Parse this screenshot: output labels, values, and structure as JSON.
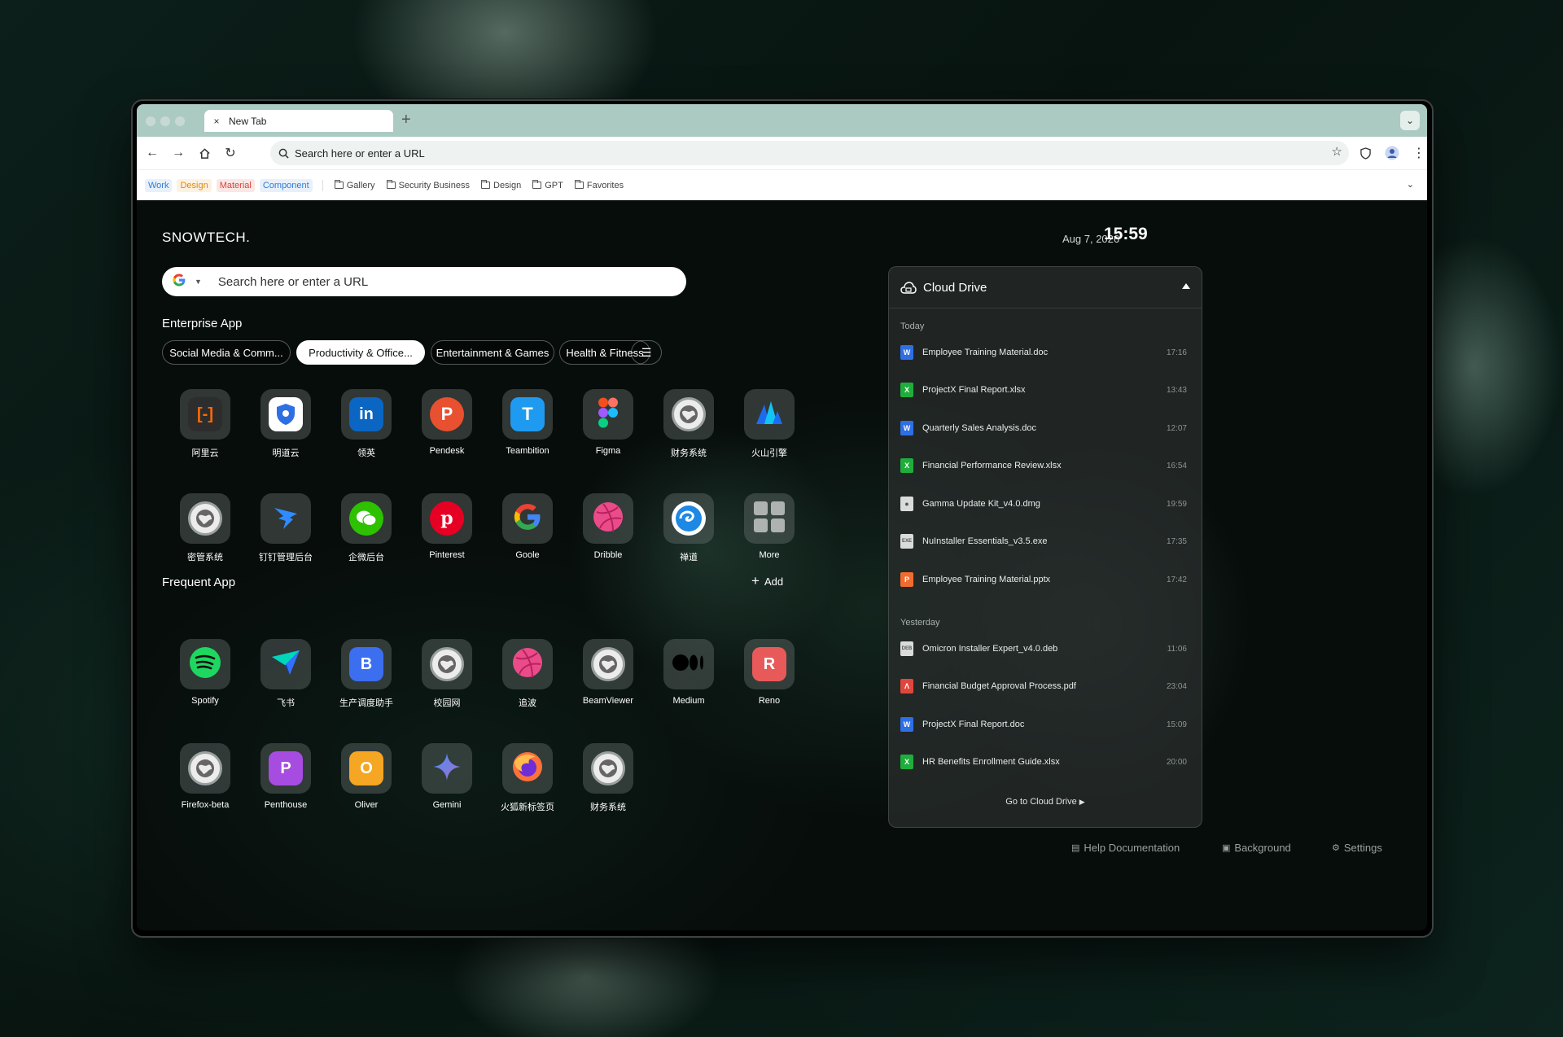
{
  "window": {
    "tab_title": "New Tab",
    "new_tab": "+",
    "tab_close": "×"
  },
  "toolbar": {
    "address_placeholder": "Search here or enter a URL"
  },
  "bookmarks": {
    "chips": [
      {
        "label": "Work",
        "color": "#2f7ed8",
        "bg": "#e7f0fb"
      },
      {
        "label": "Design",
        "color": "#e08a16",
        "bg": "#fdf1e0"
      },
      {
        "label": "Material",
        "color": "#d6463c",
        "bg": "#fbe7e5"
      },
      {
        "label": "Component",
        "color": "#2f7ed8",
        "bg": "#e7f0fb"
      }
    ],
    "folders": [
      "Gallery",
      "Security Business",
      "Design",
      "GPT",
      "Favorites"
    ]
  },
  "header": {
    "brand": "SNOWTECH.",
    "date": "Aug 7, 2026",
    "time": "15:59"
  },
  "search": {
    "placeholder": "Search here or enter a URL",
    "engine": "G"
  },
  "enterprise": {
    "title": "Enterprise App",
    "categories": [
      "Social Media & Comm...",
      "Productivity & Office...",
      "Entertainment & Games",
      "Health & Fitness"
    ],
    "active_category": 1,
    "apps": [
      {
        "label": "阿里云",
        "icon": "aliyun-icon"
      },
      {
        "label": "明道云",
        "icon": "mingdao-icon"
      },
      {
        "label": "领英",
        "icon": "linkedin-icon"
      },
      {
        "label": "Pendesk",
        "icon": "pendesk-icon"
      },
      {
        "label": "Teambition",
        "icon": "teambition-icon"
      },
      {
        "label": "Figma",
        "icon": "figma-icon"
      },
      {
        "label": "财务系统",
        "icon": "finance-system-icon"
      },
      {
        "label": "火山引擎",
        "icon": "volcengine-icon"
      },
      {
        "label": "密管系统",
        "icon": "password-system-icon"
      },
      {
        "label": "钉钉管理后台",
        "icon": "dingtalk-icon"
      },
      {
        "label": "企微后台",
        "icon": "wecom-icon"
      },
      {
        "label": "Pinterest",
        "icon": "pinterest-icon"
      },
      {
        "label": "Goole",
        "icon": "google-icon"
      },
      {
        "label": "Dribble",
        "icon": "dribbble-icon"
      },
      {
        "label": "禅道",
        "icon": "zentao-icon"
      },
      {
        "label": "More",
        "icon": "more-grid-icon"
      }
    ]
  },
  "frequent": {
    "title": "Frequent App",
    "add_label": "Add",
    "apps": [
      {
        "label": "Spotify",
        "icon": "spotify-icon"
      },
      {
        "label": "飞书",
        "icon": "feishu-icon"
      },
      {
        "label": "生产调度助手",
        "icon": "scheduler-icon",
        "letter": "B"
      },
      {
        "label": "校园网",
        "icon": "campus-net-icon"
      },
      {
        "label": "追波",
        "icon": "dribbble-icon"
      },
      {
        "label": "BeamViewer",
        "icon": "beamviewer-icon"
      },
      {
        "label": "Medium",
        "icon": "medium-icon"
      },
      {
        "label": "Reno",
        "icon": "reno-icon",
        "letter": "R"
      },
      {
        "label": "Firefox-beta",
        "icon": "firefox-beta-icon"
      },
      {
        "label": "Penthouse",
        "icon": "penthouse-icon",
        "letter": "P"
      },
      {
        "label": "Oliver",
        "icon": "oliver-icon",
        "letter": "O"
      },
      {
        "label": "Gemini",
        "icon": "gemini-icon"
      },
      {
        "label": "火狐新标签页",
        "icon": "firefox-icon"
      },
      {
        "label": "财务系统",
        "icon": "finance-system-icon"
      }
    ]
  },
  "cloud_drive": {
    "title": "Cloud Drive",
    "groups": [
      {
        "label": "Today",
        "files": [
          {
            "name": "Employee Training Material.doc",
            "time": "17:16",
            "type": "doc"
          },
          {
            "name": "ProjectX Final Report.xlsx",
            "time": "13:43",
            "type": "xls"
          },
          {
            "name": "Quarterly Sales Analysis.doc",
            "time": "12:07",
            "type": "doc"
          },
          {
            "name": "Financial Performance Review.xlsx",
            "time": "16:54",
            "type": "xls"
          },
          {
            "name": "Gamma Update Kit_v4.0.dmg",
            "time": "19:59",
            "type": "dmg"
          },
          {
            "name": "NuInstaller Essentials_v3.5.exe",
            "time": "17:35",
            "type": "exe"
          },
          {
            "name": "Employee Training Material.pptx",
            "time": "17:42",
            "type": "ppt"
          }
        ]
      },
      {
        "label": "Yesterday",
        "files": [
          {
            "name": "Omicron Installer Expert_v4.0.deb",
            "time": "11:06",
            "type": "deb"
          },
          {
            "name": "Financial Budget Approval Process.pdf",
            "time": "23:04",
            "type": "pdf"
          },
          {
            "name": "ProjectX Final Report.doc",
            "time": "15:09",
            "type": "doc"
          },
          {
            "name": "HR Benefits Enrollment Guide.xlsx",
            "time": "20:00",
            "type": "xls"
          }
        ]
      }
    ],
    "go_label": "Go to Cloud Drive"
  },
  "footer": {
    "help": "Help Documentation",
    "background": "Background",
    "settings": "Settings"
  }
}
